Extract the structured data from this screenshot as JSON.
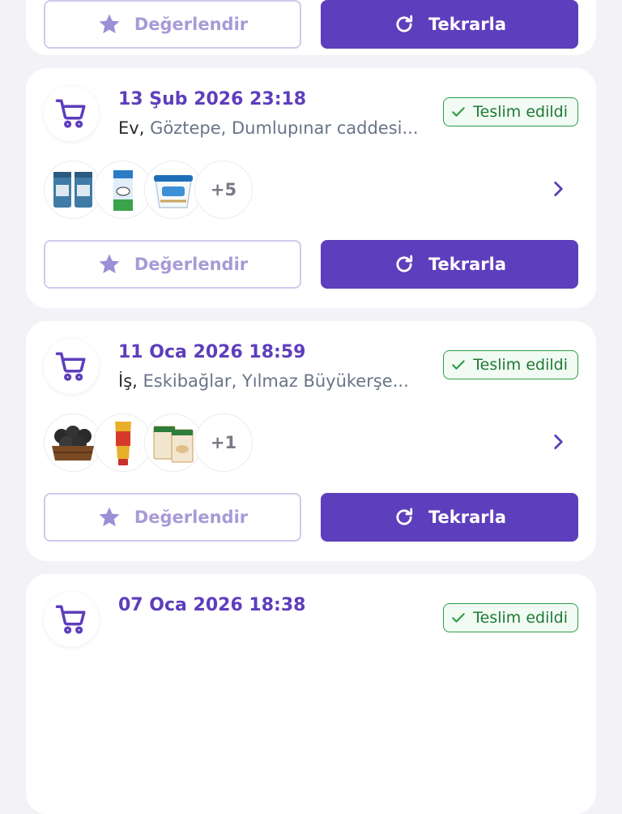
{
  "buttons": {
    "rate_label": "Değerlendir",
    "repeat_label": "Tekrarla"
  },
  "colors": {
    "brand": "#5d3ebc",
    "delivered": "#2e9c46",
    "background": "#f3f2f6"
  },
  "orders": [
    {
      "date": "13 Şub 2026 23:18",
      "address_label": "Ev,",
      "address": "Göztepe, Dumlupınar caddesi...",
      "status": "Teslim edildi",
      "products": [
        "cat-food-bags",
        "milk-carton",
        "yogurt-tub"
      ],
      "more": "+5"
    },
    {
      "date": "11 Oca 2026 18:59",
      "address_label": "İş,",
      "address": "Eskibağlar, Yılmaz Büyükerşe...",
      "status": "Teslim edildi",
      "products": [
        "charcoal-crate",
        "tomato-paste-tube",
        "pasta-boxes"
      ],
      "more": "+1"
    },
    {
      "date": "07 Oca 2026 18:38",
      "status": "Teslim edildi"
    }
  ]
}
